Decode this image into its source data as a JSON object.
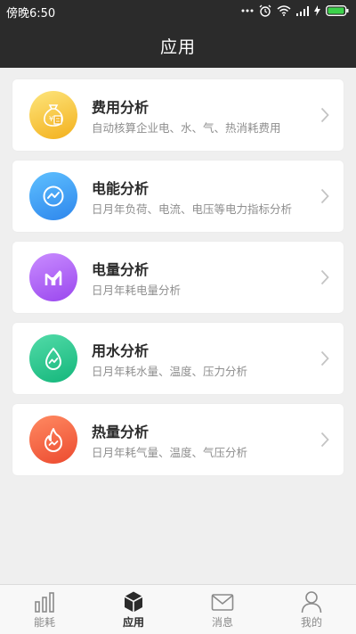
{
  "status_bar": {
    "time": "傍晚6:50"
  },
  "header": {
    "title": "应用"
  },
  "cards": [
    {
      "title": "费用分析",
      "subtitle": "自动核算企业电、水、气、热消耗费用",
      "icon": "money-bag-icon",
      "color_top": "#fde57c",
      "color_bottom": "#f3b01c"
    },
    {
      "title": "电能分析",
      "subtitle": "日月年负荷、电流、电压等电力指标分析",
      "icon": "trend-chart-icon",
      "color_top": "#5ec0ff",
      "color_bottom": "#2e86ec"
    },
    {
      "title": "电量分析",
      "subtitle": "日月年耗电量分析",
      "icon": "bar-chart-icon",
      "color_top": "#c98cff",
      "color_bottom": "#9a47ee"
    },
    {
      "title": "用水分析",
      "subtitle": "日月年耗水量、温度、压力分析",
      "icon": "water-drop-icon",
      "color_top": "#52dba8",
      "color_bottom": "#14b67b"
    },
    {
      "title": "热量分析",
      "subtitle": "日月年耗气量、温度、气压分析",
      "icon": "flame-icon",
      "color_top": "#ff8a62",
      "color_bottom": "#ec4a2f"
    }
  ],
  "tabs": [
    {
      "label": "能耗",
      "icon": "bar-graph-icon",
      "active": false
    },
    {
      "label": "应用",
      "icon": "cube-icon",
      "active": true
    },
    {
      "label": "消息",
      "icon": "envelope-icon",
      "active": false
    },
    {
      "label": "我的",
      "icon": "person-icon",
      "active": false
    }
  ]
}
